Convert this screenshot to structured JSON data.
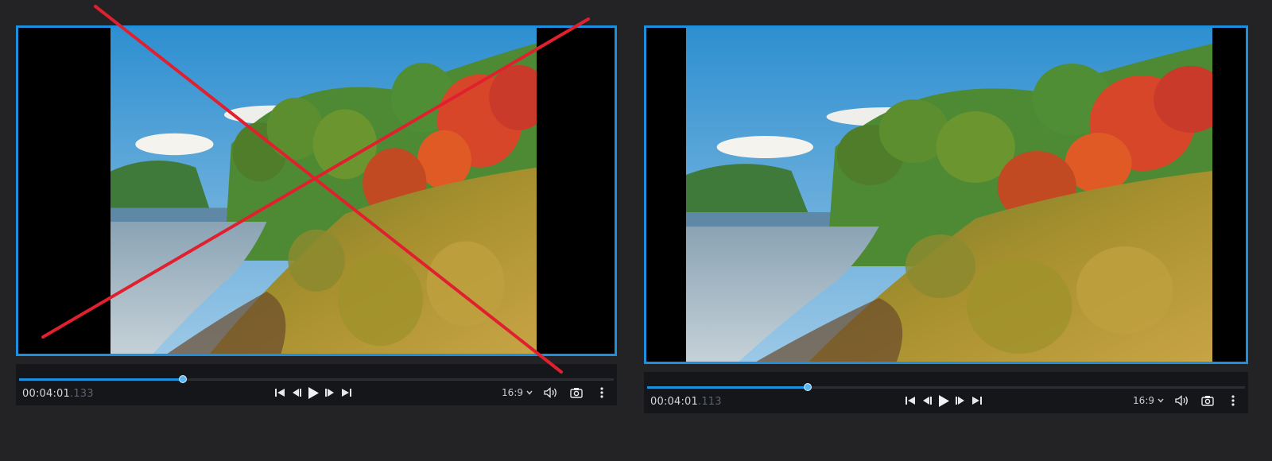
{
  "players": [
    {
      "id": "left",
      "time_main": "00:04:01",
      "time_ms": ".133",
      "aspect_label": "16:9",
      "progress": 0.276,
      "crossed_out": true
    },
    {
      "id": "right",
      "time_main": "00:04:01",
      "time_ms": ".113",
      "aspect_label": "16:9",
      "progress": 0.268,
      "crossed_out": false
    }
  ],
  "icons": {
    "transport": [
      "skip-back-icon",
      "frame-back-icon",
      "play-icon",
      "frame-forward-icon",
      "skip-forward-icon"
    ],
    "tools": [
      "volume-icon",
      "camera-icon",
      "more-icon"
    ]
  },
  "colors": {
    "accent": "#1e8fdd",
    "background": "#232325",
    "controls": "#15161a",
    "cross": "#e0202e"
  }
}
